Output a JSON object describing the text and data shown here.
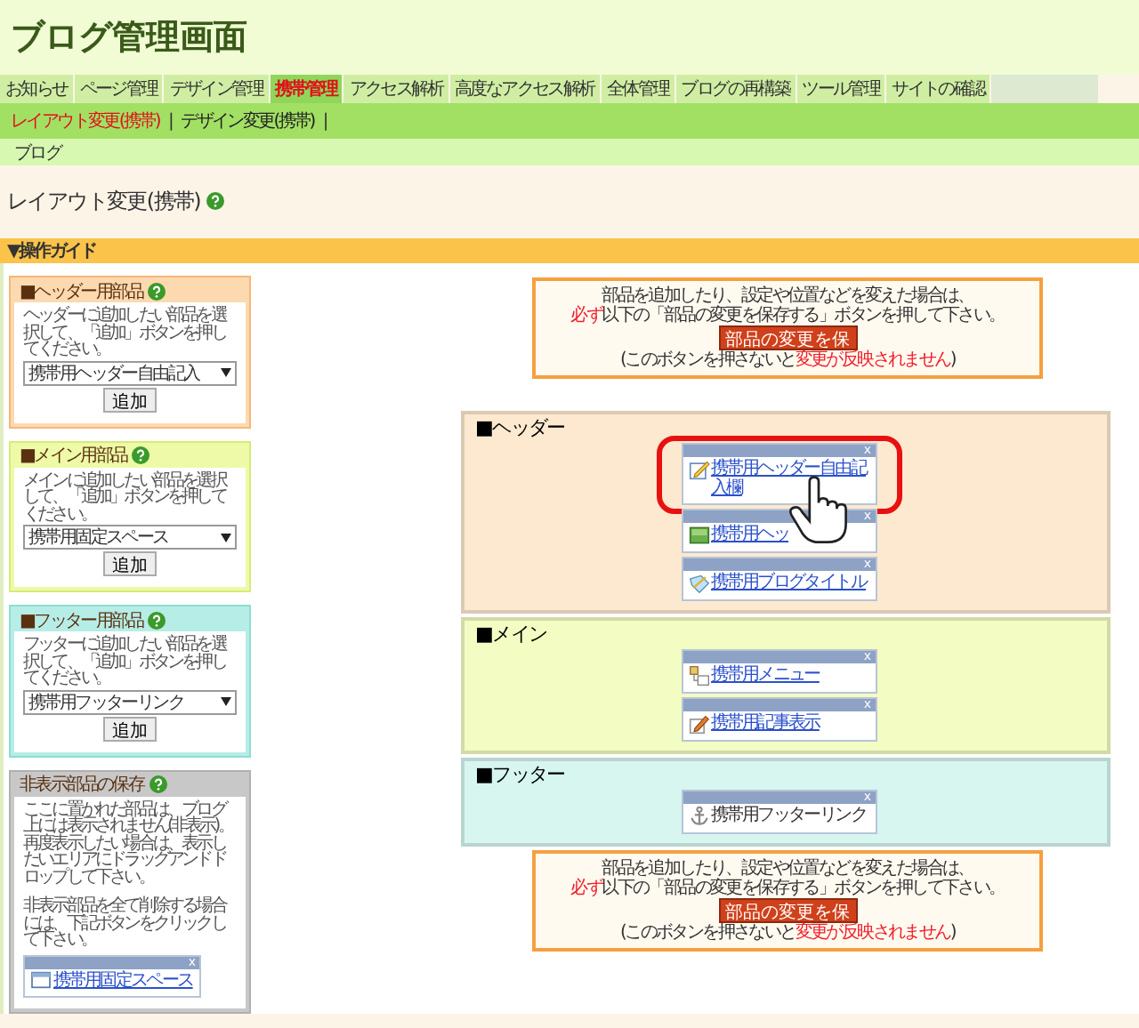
{
  "app_title": "ブログ管理画面",
  "tabs": [
    {
      "label": "お知らせ",
      "selected": false
    },
    {
      "label": "ページ管理",
      "selected": false
    },
    {
      "label": "デザイン管理",
      "selected": false
    },
    {
      "label": "携帯管理",
      "selected": true
    },
    {
      "label": "アクセス解析",
      "selected": false
    },
    {
      "label": "高度なアクセス解析",
      "selected": false
    },
    {
      "label": "全体管理",
      "selected": false
    },
    {
      "label": "ブログの再構築",
      "selected": false
    },
    {
      "label": "ツール管理",
      "selected": false
    },
    {
      "label": "サイトの確認",
      "selected": false
    }
  ],
  "subnav": [
    {
      "label": "レイアウト変更(携帯)",
      "selected": true
    },
    {
      "label": "デザイン変更(携帯)",
      "selected": false
    }
  ],
  "separator": "|",
  "breadcrumb": "ブログ",
  "page_title": "レイアウト変更(携帯)",
  "guide": "▼操作ガイド",
  "palettes": [
    {
      "kind": "part",
      "title": "■ヘッダー用部品",
      "color": "#fdd9b0",
      "description": "ヘッダーに追加したい部品を選択して、「追加」ボタンを押してください。",
      "select": "携帯用ヘッダー自由記入",
      "button": "追加"
    },
    {
      "kind": "part",
      "title": "■メイン用部品",
      "color": "#eefaa8",
      "description": "メインに追加したい部品を選択して、「追加」ボタンを押してください。",
      "select": "携帯用固定スペース",
      "button": "追加"
    },
    {
      "kind": "part",
      "title": "■フッター用部品",
      "color": "#b6ede6",
      "description": "フッターに追加したい部品を選択して、「追加」ボタンを押してください。",
      "select": "携帯用フッターリンク",
      "button": "追加"
    },
    {
      "kind": "hidden",
      "title": "非表示部品の保存",
      "color": "#c8c8c8",
      "description": "ここに置かれた部品は、ブログ上には表示されません(非表示)。再度表示したい場合は、表示したいエリアにドラッグアンドドロップして下さい。",
      "description2": "非表示部品を全て削除する場合には、下記ボタンをクリックして下さい。",
      "widget": {
        "close": "x",
        "label": "携帯用固定スペース"
      }
    }
  ],
  "notice": {
    "lines": [
      [
        {
          "text": "部品を追加したり、設定や位置などを変えた場合は、",
          "emphasis": false
        }
      ],
      [
        {
          "text": "必ず",
          "emphasis": true
        },
        {
          "text": "以下の「部品の変更を保存する」ボタンを押して下さい。",
          "emphasis": false
        }
      ]
    ],
    "button": "部品の変更を保",
    "note": [
      {
        "text": "(このボタンを押さないと",
        "emphasis": false
      },
      {
        "text": "変更が反映されません",
        "emphasis": true
      },
      {
        "text": ")",
        "emphasis": false
      }
    ]
  },
  "areas": [
    {
      "title": "■ヘッダー",
      "color": "#fde9cf",
      "widgets": [
        {
          "kind": "pencil",
          "close": "x",
          "label": "携帯用ヘッダー自由記入欄",
          "link": true,
          "highlighted": true
        },
        {
          "kind": "image",
          "close": "x",
          "label": "携帯用ヘッ",
          "link": true,
          "highlighted": false
        },
        {
          "kind": "title",
          "close": "x",
          "label": "携帯用ブログタイトル",
          "link": true,
          "highlighted": false
        }
      ]
    },
    {
      "title": "■メイン",
      "color": "#f3fcc2",
      "widgets": [
        {
          "kind": "menu",
          "close": "x",
          "label": "携帯用メニュー",
          "link": true,
          "highlighted": false
        },
        {
          "kind": "article",
          "close": "x",
          "label": "携帯用記事表示",
          "link": true,
          "highlighted": false
        }
      ]
    },
    {
      "title": "■フッター",
      "color": "#d6f6ef",
      "widgets": [
        {
          "kind": "anchor",
          "close": "x",
          "label": "携帯用フッターリンク",
          "link": false,
          "highlighted": false
        }
      ]
    }
  ],
  "notice2": {
    "lines": [
      [
        {
          "text": "部品を追加したり、設定や位置などを変えた場合は、",
          "emphasis": false
        }
      ],
      [
        {
          "text": "必ず",
          "emphasis": true
        },
        {
          "text": "以下の「部品の変更を保存する」ボタンを押して下さい。",
          "emphasis": false
        }
      ]
    ],
    "button": "部品の変更を保",
    "note": [
      {
        "text": "(このボタンを押さないと",
        "emphasis": false
      },
      {
        "text": "変更が反映されません",
        "emphasis": true
      },
      {
        "text": ")",
        "emphasis": false
      }
    ]
  }
}
